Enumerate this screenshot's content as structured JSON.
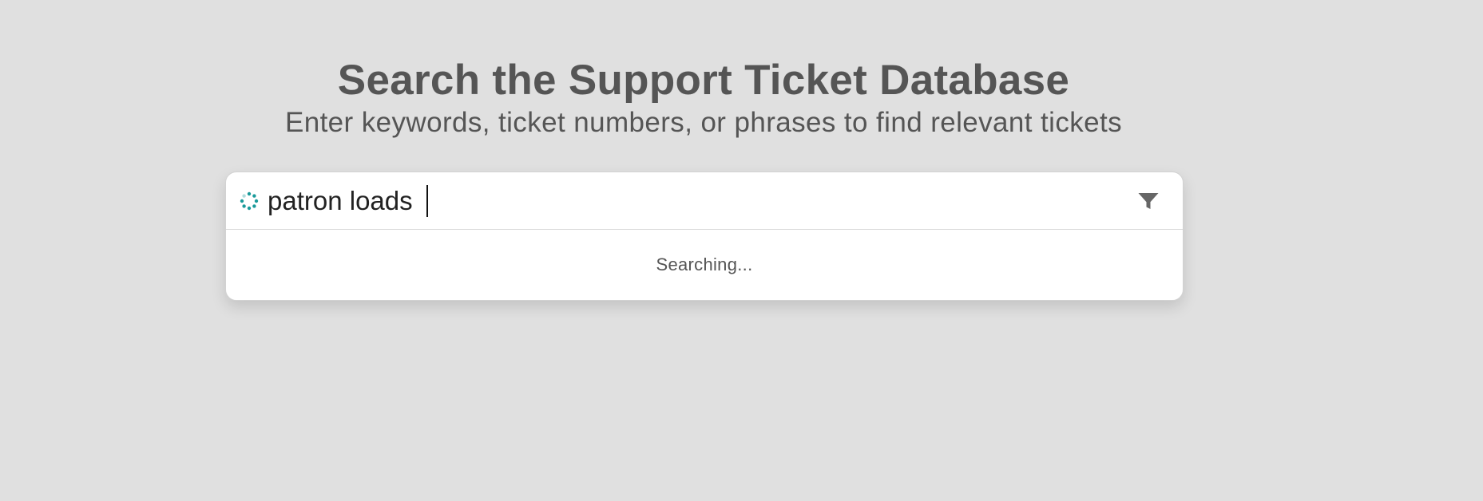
{
  "header": {
    "title": "Search the Support Ticket Database",
    "subtitle": "Enter keywords, ticket numbers, or phrases to find relevant tickets"
  },
  "search": {
    "value": "patron loads",
    "status_text": "Searching...",
    "spinner_icon": "loading-spinner-icon",
    "filter_icon": "filter-icon"
  },
  "colors": {
    "background": "#e0e0e0",
    "spinner": "#1a9a9a",
    "text": "#555555"
  }
}
